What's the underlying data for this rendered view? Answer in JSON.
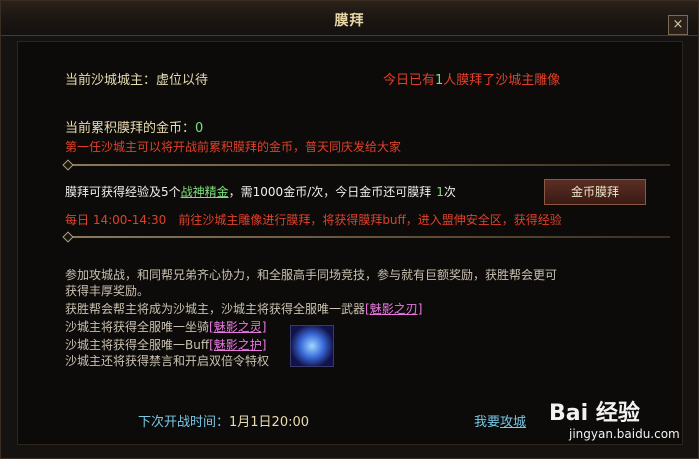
{
  "window": {
    "title": "膜拜",
    "close_label": "×"
  },
  "castle_owner": {
    "label": "当前沙城城主：",
    "value": "虚位以待"
  },
  "today": {
    "prefix": "今日已有",
    "count": "1",
    "suffix": "人膜拜了沙城主雕像"
  },
  "gold": {
    "label": "当前累积膜拜的金币：",
    "amount": "0",
    "note": "第一任沙城主可以将开战前累积膜拜的金币，普天同庆发给大家"
  },
  "worship": {
    "text1": "膜拜可获得经验及5个",
    "item_link": "战神精金",
    "text2": "，需1000金币/次，今日金币还可膜拜",
    "remaining": "1",
    "text3": "次",
    "button_label": "金币膜拜"
  },
  "daily": {
    "label": "每日 14:00-14:30",
    "desc": "前往沙城主雕像进行膜拜，将获得膜拜buff，进入盟伸安全区，获得经验"
  },
  "info": {
    "line1": "参加攻城战，和同帮兄弟齐心协力，和全服高手同场竞技，参与就有巨额奖励，获胜帮会更可",
    "line2": "获得丰厚奖励。",
    "line3_text": "获胜帮会帮主将成为沙城主，沙城主将获得全服唯一武器",
    "line3_link": "[魅影之刃]",
    "line4_text": "沙城主将获得全服唯一坐骑",
    "line4_link": "[魅影之灵]",
    "line5_text": "沙城主将获得全服唯一Buff",
    "line5_link": "[魅影之护]",
    "line6_text": "沙城主还将获得禁言和开启双倍令特权"
  },
  "next_battle": {
    "label": "下次开战时间：",
    "time": "1月1日20:00"
  },
  "join": {
    "text": "我要",
    "link": "攻城"
  },
  "watermark": {
    "brand": "Bai 经验",
    "url": "jingyan.baidu.com"
  },
  "icons": [
    "close-icon",
    "diamond-knob-icon",
    "wings-icon",
    "baidu-paw-icon"
  ]
}
